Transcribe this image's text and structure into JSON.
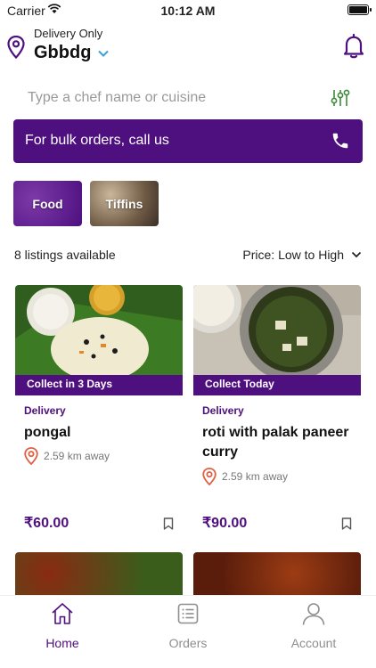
{
  "status_bar": {
    "carrier": "Carrier",
    "time": "10:12 AM"
  },
  "header": {
    "subtitle": "Delivery Only",
    "location": "Gbbdg",
    "icons": {
      "location": "map-pin-icon",
      "dropdown": "chevron-down-icon",
      "notifications": "bell-icon"
    }
  },
  "search": {
    "placeholder": "Type a chef name or cuisine",
    "filter_icon": "sliders-icon"
  },
  "bulk_banner": {
    "label": "For bulk orders, call us",
    "icon": "phone-icon"
  },
  "categories": [
    {
      "label": "Food"
    },
    {
      "label": "Tiffins"
    }
  ],
  "listing_summary": {
    "count_text": "8 listings available",
    "sort_label": "Price: Low to High"
  },
  "listings": [
    {
      "collect": "Collect in 3 Days",
      "mode": "Delivery",
      "name": "pongal",
      "distance": "2.59 km away",
      "price": "₹60.00"
    },
    {
      "collect": "Collect Today",
      "mode": "Delivery",
      "name": "roti with palak paneer curry",
      "distance": "2.59 km away",
      "price": "₹90.00"
    }
  ],
  "tabbar": [
    {
      "label": "Home",
      "icon": "home-icon",
      "active": true
    },
    {
      "label": "Orders",
      "icon": "orders-icon",
      "active": false
    },
    {
      "label": "Account",
      "icon": "account-icon",
      "active": false
    }
  ],
  "colors": {
    "brand": "#4e0f7f",
    "accent": "#3aa0d6",
    "pin": "#e06045",
    "filter": "#3a8a3a"
  }
}
